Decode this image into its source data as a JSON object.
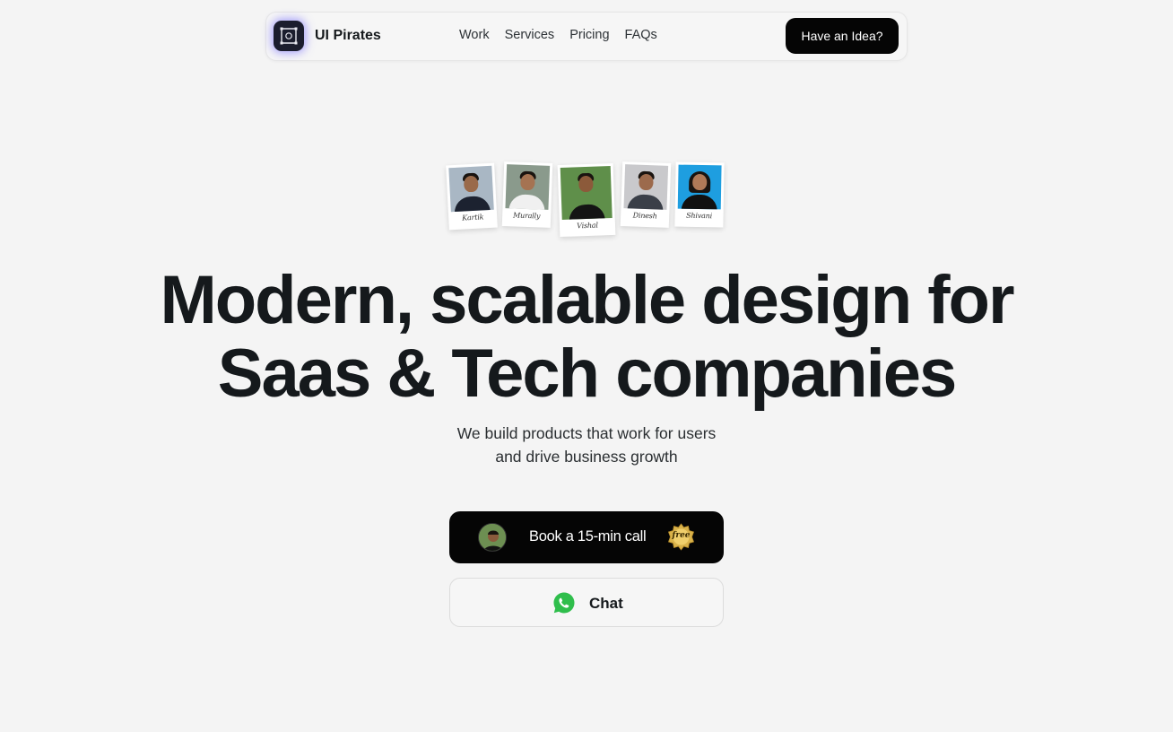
{
  "nav": {
    "brand": "UI Pirates",
    "links": [
      "Work",
      "Services",
      "Pricing",
      "FAQs"
    ],
    "cta": "Have an Idea?"
  },
  "team": [
    {
      "signature": "Kartik"
    },
    {
      "signature": "Murally"
    },
    {
      "signature": "Vishal"
    },
    {
      "signature": "Dinesh"
    },
    {
      "signature": "Shivani"
    }
  ],
  "hero": {
    "headline_line1": "Modern, scalable design for",
    "headline_line2": "Saas & Tech companies",
    "sub_line1": "We build products that work for users",
    "sub_line2": "and drive business growth"
  },
  "actions": {
    "book_label": "Book a 15-min call",
    "free_badge": "free",
    "chat_label": "Chat"
  },
  "colors": {
    "background": "#f4f4f4",
    "primary_button": "#050505",
    "text": "#15191c",
    "whatsapp": "#2fbe4c",
    "badge_gold": "#d9b24a"
  }
}
